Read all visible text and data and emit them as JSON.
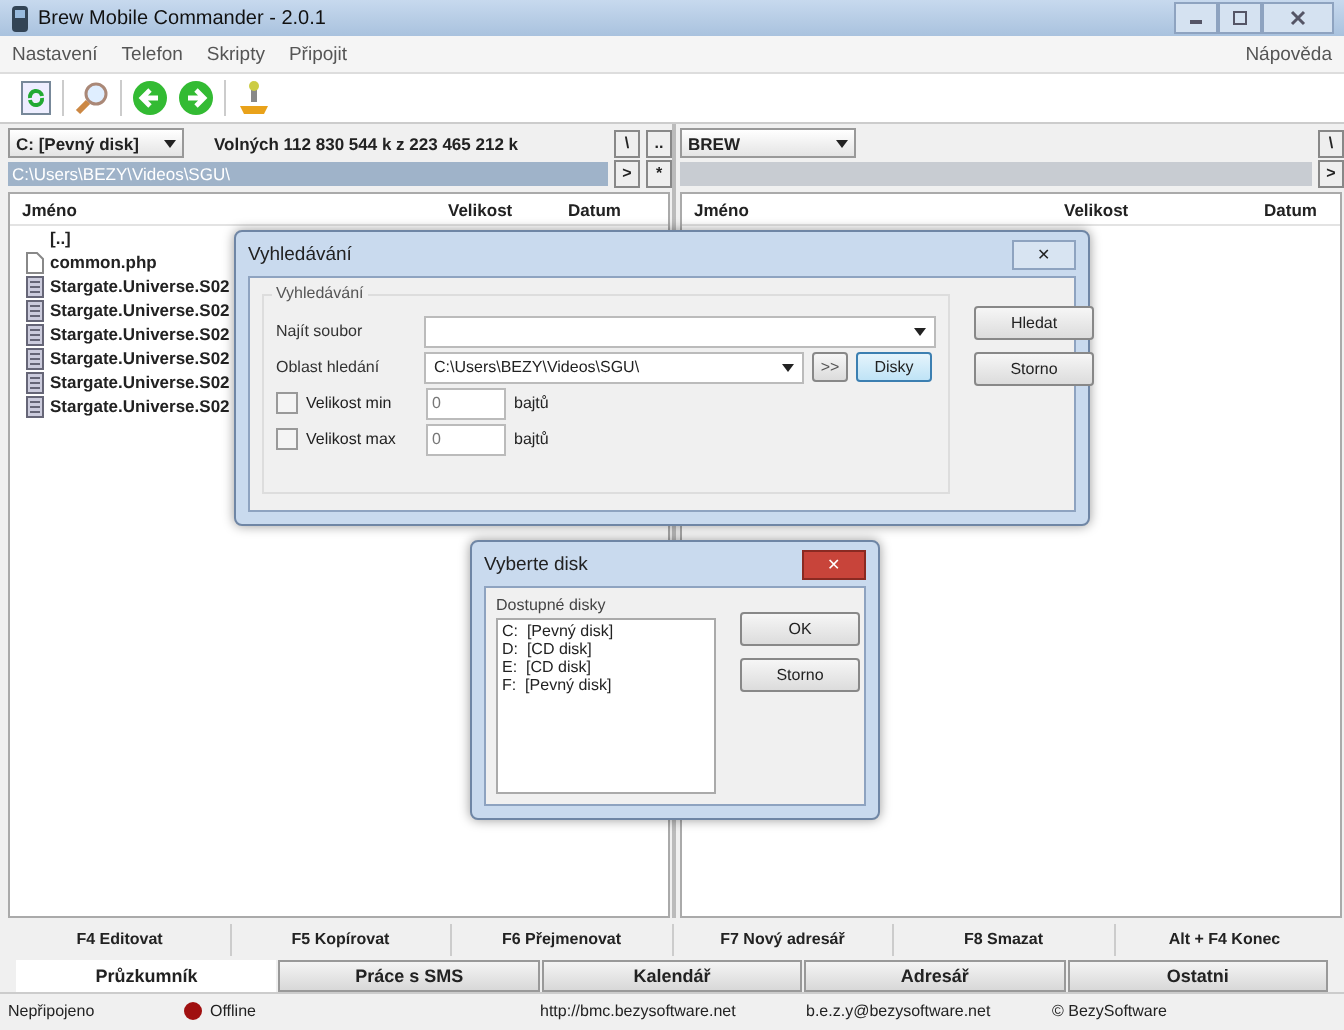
{
  "window": {
    "title": "Brew Mobile Commander - 2.0.1"
  },
  "menu": [
    {
      "label": "Nastavení"
    },
    {
      "label": "Telefon"
    },
    {
      "label": "Skripty"
    },
    {
      "label": "Připojit"
    }
  ],
  "help_menu": "Nápověda",
  "left_panel": {
    "drive": "C: [Pevný disk]",
    "free_space": "Volných 112 830 544 k z 223 465 212 k",
    "nav_buttons": [
      "\\",
      "..",
      ">",
      "*"
    ],
    "path": "C:\\Users\\BEZY\\Videos\\SGU\\",
    "columns": [
      "Jméno",
      "Velikost",
      "Datum"
    ],
    "files": [
      {
        "name": "[..]",
        "kind": "up"
      },
      {
        "name": "common.php",
        "kind": "file"
      },
      {
        "name": "Stargate.Universe.S02",
        "kind": "video"
      },
      {
        "name": "Stargate.Universe.S02",
        "kind": "video"
      },
      {
        "name": "Stargate.Universe.S02",
        "kind": "video"
      },
      {
        "name": "Stargate.Universe.S02",
        "kind": "video"
      },
      {
        "name": "Stargate.Universe.S02",
        "kind": "video"
      },
      {
        "name": "Stargate.Universe.S02",
        "kind": "video"
      }
    ]
  },
  "right_panel": {
    "drive": "BREW",
    "nav_buttons": [
      "\\",
      ">"
    ],
    "columns": [
      "Jméno",
      "Velikost",
      "Datum"
    ]
  },
  "search_dialog": {
    "title": "Vyhledávání",
    "close": "✕",
    "group": "Vyhledávání",
    "find_label": "Najít soubor",
    "area_label": "Oblast hledání",
    "area_value": "C:\\Users\\BEZY\\Videos\\SGU\\",
    "more_button": ">>",
    "disks_button": "Disky",
    "size_min": {
      "label": "Velikost min",
      "checked": false,
      "value": "0",
      "unit": "bajtů"
    },
    "size_max": {
      "label": "Velikost max",
      "checked": false,
      "value": "0",
      "unit": "bajtů"
    },
    "buttons": [
      "Hledat",
      "Storno"
    ]
  },
  "disk_dialog": {
    "title": "Vyberte disk",
    "close": "✕",
    "group": "Dostupné disky",
    "disks": [
      "C:  [Pevný disk]",
      "D:  [CD disk]",
      "E:  [CD disk]",
      "F:  [Pevný disk]"
    ],
    "buttons": [
      "OK",
      "Storno"
    ]
  },
  "function_keys": [
    "F4 Editovat",
    "F5 Kopírovat",
    "F6 Přejmenovat",
    "F7 Nový adresář",
    "F8 Smazat",
    "Alt + F4 Konec"
  ],
  "tabs": [
    {
      "label": "Průzkumník",
      "selected": true
    },
    {
      "label": "Práce s SMS",
      "selected": false
    },
    {
      "label": "Kalendář",
      "selected": false
    },
    {
      "label": "Adresář",
      "selected": false
    },
    {
      "label": "Ostatni",
      "selected": false
    }
  ],
  "status_bar": {
    "connection": "Nepřipojeno",
    "state": "Offline",
    "connected": false,
    "url": "http://bmc.bezysoftware.net",
    "email": "b.e.z.y@bezysoftware.net",
    "copyright": "© BezySoftware"
  }
}
